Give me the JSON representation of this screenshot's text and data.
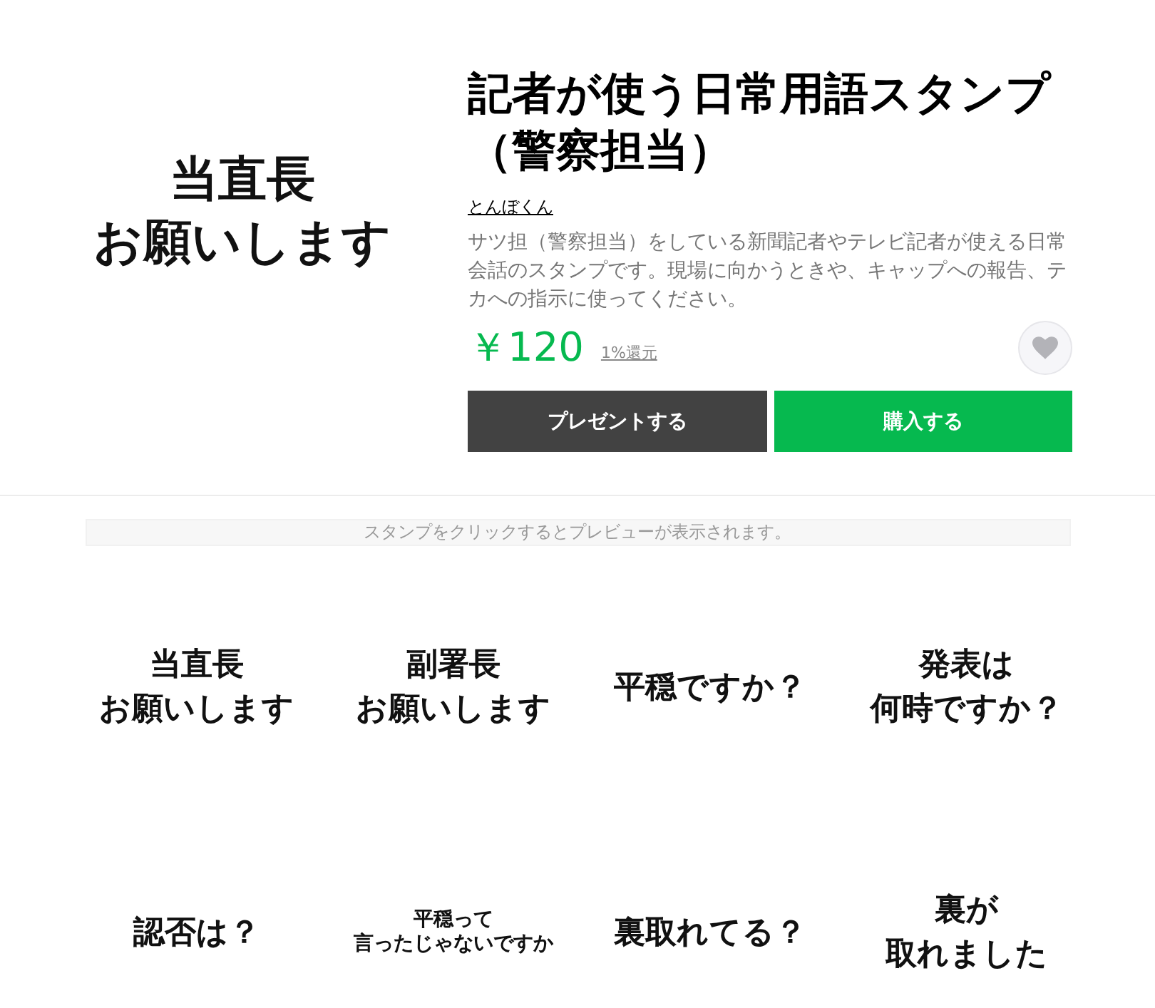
{
  "product": {
    "image_lines": [
      "当直長",
      "お願いします"
    ],
    "title": "記者が使う日常用語スタンプ（警察担当）",
    "author": "とんぼくん",
    "description": "サツ担（警察担当）をしている新聞記者やテレビ記者が使える日常会話のスタンプです。現場に向かうときや、キャップへの報告、テカへの指示に使ってください。",
    "price": "￥120",
    "points": "1%還元",
    "favorited": false
  },
  "buttons": [
    {
      "label": "プレゼントする",
      "kind": "gift"
    },
    {
      "label": "購入する",
      "kind": "buy"
    }
  ],
  "hint": "スタンプをクリックするとプレビューが表示されます。",
  "stamps": [
    {
      "kind": "large",
      "lines": [
        "当直長",
        "お願いします"
      ]
    },
    {
      "kind": "large",
      "lines": [
        "副署長",
        "お願いします"
      ]
    },
    {
      "kind": "large",
      "lines": [
        "平穏ですか？"
      ]
    },
    {
      "kind": "large",
      "lines": [
        "発表は",
        "何時ですか？"
      ]
    },
    {
      "kind": "large",
      "lines": [
        "認否は？"
      ]
    },
    {
      "kind": "small",
      "lines": [
        "平穏って",
        "言ったじゃないですか"
      ]
    },
    {
      "kind": "large",
      "lines": [
        "裏取れてる？"
      ]
    },
    {
      "kind": "large",
      "lines": [
        "裏が",
        "取れました"
      ]
    }
  ]
}
